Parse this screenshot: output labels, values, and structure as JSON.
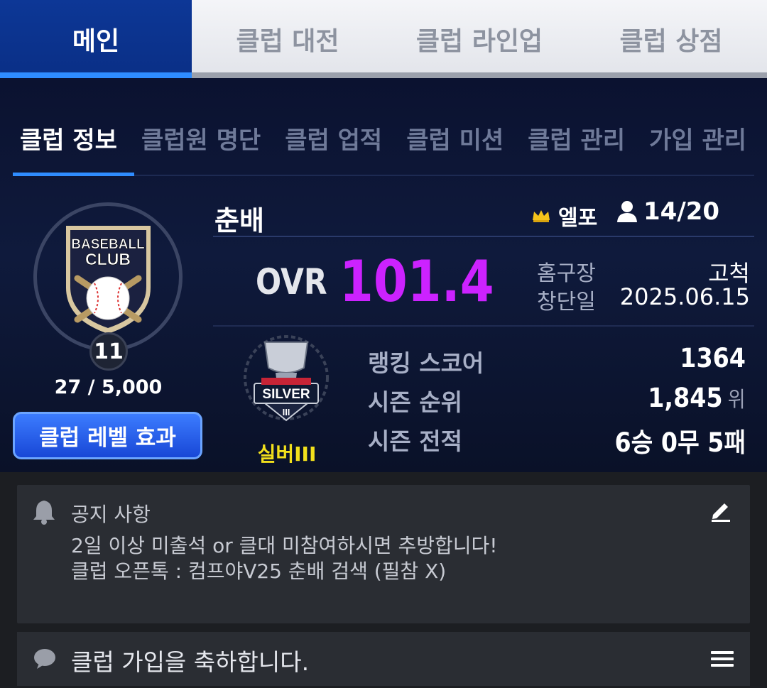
{
  "top_tabs": [
    {
      "label": "메인",
      "active": true
    },
    {
      "label": "클럽 대전",
      "active": false
    },
    {
      "label": "클럽 라인업",
      "active": false
    },
    {
      "label": "클럽 상점",
      "active": false
    }
  ],
  "sub_tabs": [
    {
      "label": "클럽 정보",
      "active": true
    },
    {
      "label": "클럽원 명단",
      "active": false
    },
    {
      "label": "클럽 업적",
      "active": false
    },
    {
      "label": "클럽 미션",
      "active": false
    },
    {
      "label": "클럽 관리",
      "active": false
    },
    {
      "label": "가입 관리",
      "active": false
    }
  ],
  "club": {
    "emblem_line1": "BASEBALL",
    "emblem_line2": "CLUB",
    "level": "11",
    "exp": "27 / 5,000",
    "level_effect_button": "클럽 레벨 효과",
    "name": "춘배",
    "role": "엘포",
    "members": "14/20",
    "ovr_label": "OVR",
    "ovr_value": "101.4",
    "stadium_label": "홈구장",
    "stadium_value": "고척",
    "founded_label": "창단일",
    "founded_value": "2025.06.15"
  },
  "tier": {
    "badge_text": "SILVER",
    "badge_roman": "III",
    "label": "실버III"
  },
  "stats": {
    "ranking_score_label": "랭킹 스코어",
    "ranking_score_value": "1364",
    "season_rank_label": "시즌 순위",
    "season_rank_value": "1,845",
    "season_rank_unit": "위",
    "season_record_label": "시즌 전적",
    "season_record_value": "6승 0무 5패"
  },
  "notice": {
    "title": "공지 사항",
    "line1": "2일 이상 미출석 or 클대 미참여하시면 추방합니다!",
    "line2": "클럽 오픈톡 : 컴프야V25 춘배 검색 (필참 X)"
  },
  "welcome": {
    "text": "클럽 가입을 축하합니다."
  },
  "colors": {
    "ovr": "#cc22ff",
    "tier_label": "#f2e01c",
    "tab_active_bg": "#0d3796",
    "accent_blue": "#2f8cff"
  }
}
